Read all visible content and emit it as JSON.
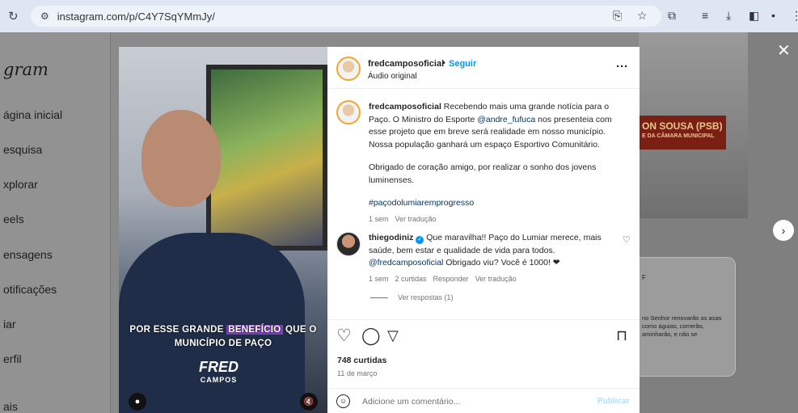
{
  "browser": {
    "url": "instagram.com/p/C4Y7SqYMmJy/",
    "reload_icon": "reload-icon",
    "tune_icon": "site-settings-icon"
  },
  "sidebar": {
    "logo": "gram",
    "items": [
      {
        "label": "ágina inicial"
      },
      {
        "label": "esquisa"
      },
      {
        "label": "xplorar"
      },
      {
        "label": "eels"
      },
      {
        "label": "ensagens"
      },
      {
        "label": "otificações"
      },
      {
        "label": "iar"
      },
      {
        "label": "erfil"
      },
      {
        "label": "ais"
      }
    ]
  },
  "background": {
    "banner_line1": "ON SOUSA (PSB)",
    "banner_line2": "E DA CÂMARA MUNICIPAL",
    "card_label": "F",
    "card_text": "no Senhor renovarão as asas como águias; correrão, aminharão, e não se"
  },
  "video": {
    "caption_pre": "POR ESSE GRANDE ",
    "caption_highlight": "BENEFÍCIO",
    "caption_post": " QUE O",
    "caption_line2": "MUNICÍPIO DE PAÇO",
    "brand": "FRED",
    "brand_sub": "CAMPOS"
  },
  "post": {
    "username": "fredcamposoficial",
    "separator": "•",
    "follow_label": "Seguir",
    "audio": "Áudio original",
    "caption_username": "fredcamposoficial",
    "caption_part1": " Recebendo mais uma grande notícia para o Paço. O Ministro do Esporte ",
    "caption_mention": "@andre_fufuca",
    "caption_part2": " nos presenteia com esse projeto que em breve será realidade em nosso município. Nossa população ganhará um espaço Esportivo Comunitário.",
    "caption_para2": "Obrigado de coração amigo, por realizar o sonho dos jovens luminenses.",
    "hashtag": "#paçodolumiaremprogresso",
    "caption_time": "1 sem",
    "caption_translate": "Ver tradução",
    "comment": {
      "username": "thiegodiniz",
      "text_part1": " Que maravilha!! Paço do Lumiar merece, mais saúde, bem estar e qualidade de vida para todos. ",
      "mention": "@fredcamposoficial",
      "text_part2": " Obrigado viu? Você é 1000! ❤",
      "time": "1 sem",
      "likes": "2 curtidas",
      "reply": "Responder",
      "translate": "Ver tradução"
    },
    "view_replies": "Ver respostas (1)",
    "likes": "748 curtidas",
    "date": "11 de março",
    "comment_placeholder": "Adicione um comentário...",
    "publish_label": "Publicar"
  },
  "colors": {
    "accent": "#0095f6",
    "link": "#00376b",
    "highlight": "#7b3fb8"
  }
}
